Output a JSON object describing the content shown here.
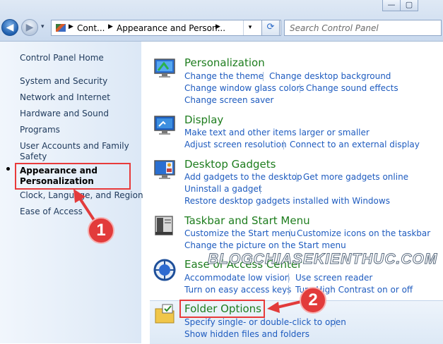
{
  "window": {
    "minimize": "—",
    "maximize": "▢"
  },
  "nav": {
    "back_glyph": "◀",
    "forward_glyph": "▶",
    "dropdown_glyph": "▾"
  },
  "address": {
    "crumbs": [
      "Cont...",
      "Appearance and Person..."
    ],
    "separator_glyph": "▶",
    "dropdown_glyph": "▾",
    "icon": "control-panel-icon"
  },
  "refresh": {
    "glyph": "⟳",
    "icon": "refresh-icon"
  },
  "search": {
    "placeholder": "Search Control Panel",
    "icon": "search-icon"
  },
  "sidebar": {
    "items": [
      "Control Panel Home",
      "System and Security",
      "Network and Internet",
      "Hardware and Sound",
      "Programs",
      "User Accounts and Family",
      "Safety",
      "Appearance and",
      "Personalization",
      "Clock, Language, and Region",
      "Ease of Access"
    ]
  },
  "categories": {
    "personalization": {
      "title": "Personalization",
      "links": [
        "Change the theme",
        "Change desktop background",
        "Change window glass colors",
        "Change sound effects",
        "Change screen saver"
      ],
      "icon": "personalization-icon"
    },
    "display": {
      "title": "Display",
      "links": [
        "Make text and other items larger or smaller",
        "Adjust screen resolution",
        "Connect to an external display"
      ],
      "icon": "display-icon"
    },
    "gadgets": {
      "title": "Desktop Gadgets",
      "links": [
        "Add gadgets to the desktop",
        "Get more gadgets online",
        "Uninstall a gadget",
        "Restore desktop gadgets installed with Windows"
      ],
      "icon": "gadgets-icon"
    },
    "taskbar": {
      "title": "Taskbar and Start Menu",
      "links": [
        "Customize the Start menu",
        "Customize icons on the taskbar",
        "Change the picture on the Start menu"
      ],
      "icon": "taskbar-icon"
    },
    "ease": {
      "title": "Ease of Access Center",
      "links": [
        "Accommodate low vision",
        "Use screen reader",
        "Turn on easy access keys",
        "Turn High Contrast on or off"
      ],
      "icon": "ease-of-access-icon"
    },
    "folder": {
      "title": "Folder Options",
      "links": [
        "Specify single- or double-click to open",
        "Show hidden files and folders"
      ],
      "icon": "folder-options-icon"
    }
  },
  "annotations": {
    "badge1": "1",
    "badge2": "2",
    "watermark": "BLOGCHIASEKIENTHUC.COM",
    "accent": "#e23b3b"
  }
}
